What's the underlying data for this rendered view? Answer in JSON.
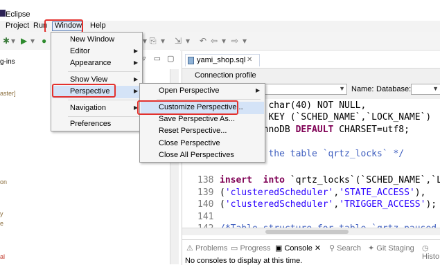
{
  "window": {
    "title": "Eclipse"
  },
  "menubar": {
    "items": [
      {
        "id": "project",
        "label": "Project"
      },
      {
        "id": "run",
        "label": "Run"
      },
      {
        "id": "window",
        "label": "Window"
      },
      {
        "id": "help",
        "label": "Help"
      }
    ]
  },
  "left_panel": {
    "tab_label": "g-ins",
    "texts": [
      "aster]",
      "on",
      "y",
      "e",
      "al"
    ]
  },
  "window_menu": {
    "items": [
      "New Window",
      "Editor",
      "Appearance",
      "Show View",
      "Perspective",
      "Navigation",
      "Preferences"
    ]
  },
  "perspective_submenu": {
    "items": [
      "Open Perspective",
      "Customize Perspective...",
      "Save Perspective As...",
      "Reset Perspective...",
      "Close Perspective",
      "Close All Perspectives"
    ]
  },
  "editor": {
    "tab_label": "yami_shop.sql",
    "connection_label": "Connection profile",
    "name_label": "Name:",
    "database_label": "Database:",
    "lines": [
      {
        "no": "",
        "parts": [
          {
            "t": "       ",
            "c": ""
          },
          {
            "t": "  char(40) NOT NULL,",
            "c": ""
          }
        ]
      },
      {
        "no": "",
        "parts": [
          {
            "t": "       Y KEY (`SCHED_NAME`,`LOCK_NAME`)",
            "c": ""
          }
        ]
      },
      {
        "no": "",
        "parts": [
          {
            "t": "      =InnoDB ",
            "c": ""
          },
          {
            "t": "DEFAULT",
            "c": "kw"
          },
          {
            "t": " CHARSET=utf8;",
            "c": ""
          }
        ]
      },
      {
        "no": "",
        "parts": [
          {
            "t": "",
            "c": ""
          }
        ]
      },
      {
        "no": "",
        "parts": [
          {
            "t": "      or the table `qrtz_locks` */",
            "c": "cm"
          }
        ]
      },
      {
        "no": "",
        "parts": [
          {
            "t": "",
            "c": ""
          }
        ]
      },
      {
        "no": "138",
        "parts": [
          {
            "t": "insert",
            "c": "kw"
          },
          {
            "t": "  ",
            "c": ""
          },
          {
            "t": "into",
            "c": "kw"
          },
          {
            "t": " `qrtz_locks`(`SCHED_NAME`,`LOC",
            "c": ""
          }
        ]
      },
      {
        "no": "139",
        "parts": [
          {
            "t": "(",
            "c": ""
          },
          {
            "t": "'clusteredScheduler'",
            "c": "str"
          },
          {
            "t": ",",
            "c": ""
          },
          {
            "t": "'STATE_ACCESS'",
            "c": "str"
          },
          {
            "t": "),",
            "c": ""
          }
        ]
      },
      {
        "no": "140",
        "parts": [
          {
            "t": "(",
            "c": ""
          },
          {
            "t": "'clusteredScheduler'",
            "c": "str"
          },
          {
            "t": ",",
            "c": ""
          },
          {
            "t": "'TRIGGER_ACCESS'",
            "c": "str"
          },
          {
            "t": ");",
            "c": ""
          }
        ]
      },
      {
        "no": "141",
        "parts": [
          {
            "t": "",
            "c": ""
          }
        ]
      },
      {
        "no": "142",
        "parts": [
          {
            "t": "/*Table structure for table `qrtz_paused_",
            "c": "cm"
          }
        ]
      }
    ]
  },
  "bottom_panel": {
    "tabs": [
      "Problems",
      "Progress",
      "Console",
      "Search",
      "Git Staging",
      "Histo"
    ],
    "message": "No consoles to display at this time."
  }
}
